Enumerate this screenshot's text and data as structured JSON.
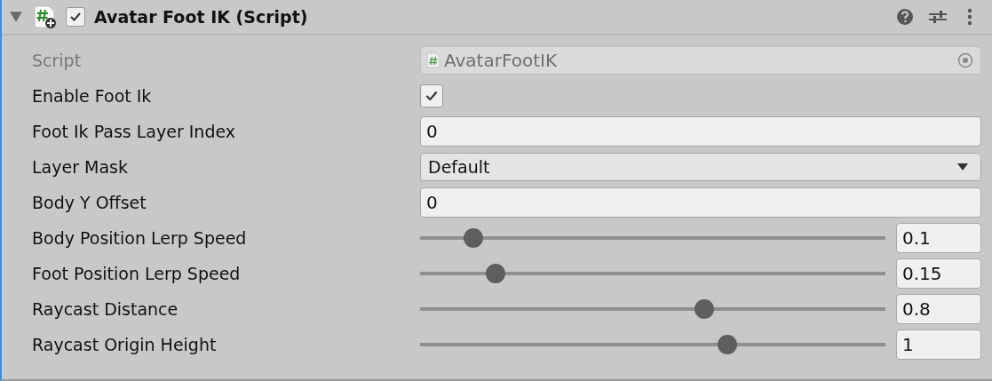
{
  "component": {
    "title": "Avatar Foot IK (Script)",
    "enabled": true,
    "expanded": true
  },
  "fields": [
    {
      "kind": "object",
      "label": "Script",
      "value": "AvatarFootIK"
    },
    {
      "kind": "checkbox",
      "label": "Enable Foot Ik",
      "checked": true
    },
    {
      "kind": "text",
      "label": "Foot Ik Pass Layer Index",
      "value": "0"
    },
    {
      "kind": "dropdown",
      "label": "Layer Mask",
      "value": "Default"
    },
    {
      "kind": "text",
      "label": "Body Y Offset",
      "value": "0"
    },
    {
      "kind": "slider",
      "label": "Body Position Lerp Speed",
      "level": 0.115,
      "value": "0.1"
    },
    {
      "kind": "slider",
      "label": "Foot Position Lerp Speed",
      "level": 0.162,
      "value": "0.15"
    },
    {
      "kind": "slider",
      "label": "Raycast Distance",
      "level": 0.61,
      "value": "0.8"
    },
    {
      "kind": "slider",
      "label": "Raycast Origin Height",
      "level": 0.66,
      "value": "1"
    }
  ]
}
